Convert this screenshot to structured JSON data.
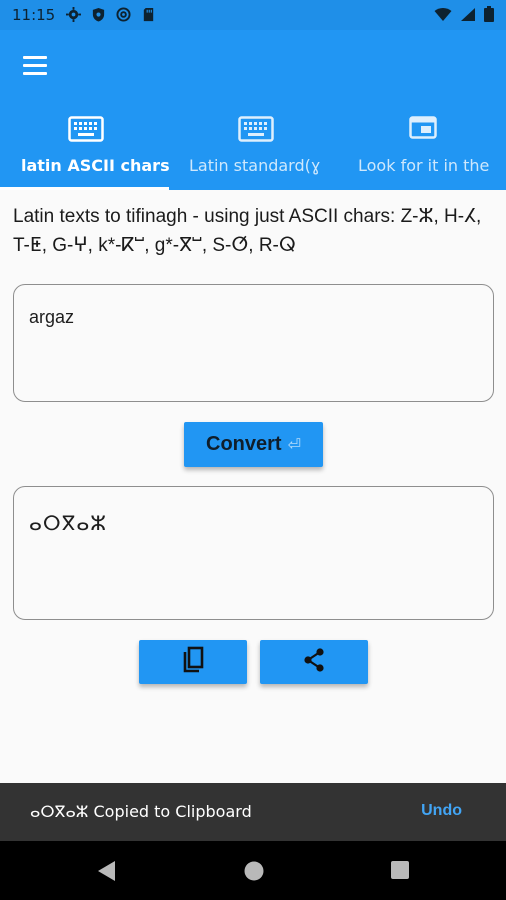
{
  "status_bar": {
    "time": "11:15",
    "left_icons": [
      "settings-icon",
      "shield-icon",
      "at-icon",
      "sd-card-icon"
    ],
    "right_icons": [
      "wifi-icon",
      "signal-icon",
      "battery-icon"
    ]
  },
  "app_bar": {
    "menu_icon": "hamburger-menu-icon",
    "tabs": [
      {
        "label": "latin ASCII chars",
        "icon": "keyboard-icon",
        "active": true
      },
      {
        "label": "Latin standard(ɣ",
        "icon": "keyboard-icon",
        "active": false
      },
      {
        "label": "Look for it in the",
        "icon": "web-asset-icon",
        "active": false
      }
    ]
  },
  "main": {
    "description": "Latin texts to tifinagh - using just ASCII chars: Z-ⵣ, H-ⵃ, T-ⵟ, G-ⵖ, k*-ⴽⵯ, g*-ⴳⵯ, S-ⵚ, R-ⵕ",
    "input_value": "argaz",
    "convert_label": "Convert",
    "convert_enter_symbol": "⏎",
    "output_value": "ⴰⵔⴳⴰⵣ",
    "copy_icon": "copy-icon",
    "share_icon": "share-icon"
  },
  "snackbar": {
    "message": "ⴰⵔⴳⴰⵣ Copied to Clipboard",
    "action": "Undo"
  },
  "nav_bar": {
    "buttons": [
      "back-icon",
      "home-icon",
      "recents-icon"
    ]
  },
  "colors": {
    "primary": "#2196f3",
    "status_bar": "#1f8fe8",
    "snackbar": "#333333",
    "snackbar_action": "#42a5f5"
  }
}
